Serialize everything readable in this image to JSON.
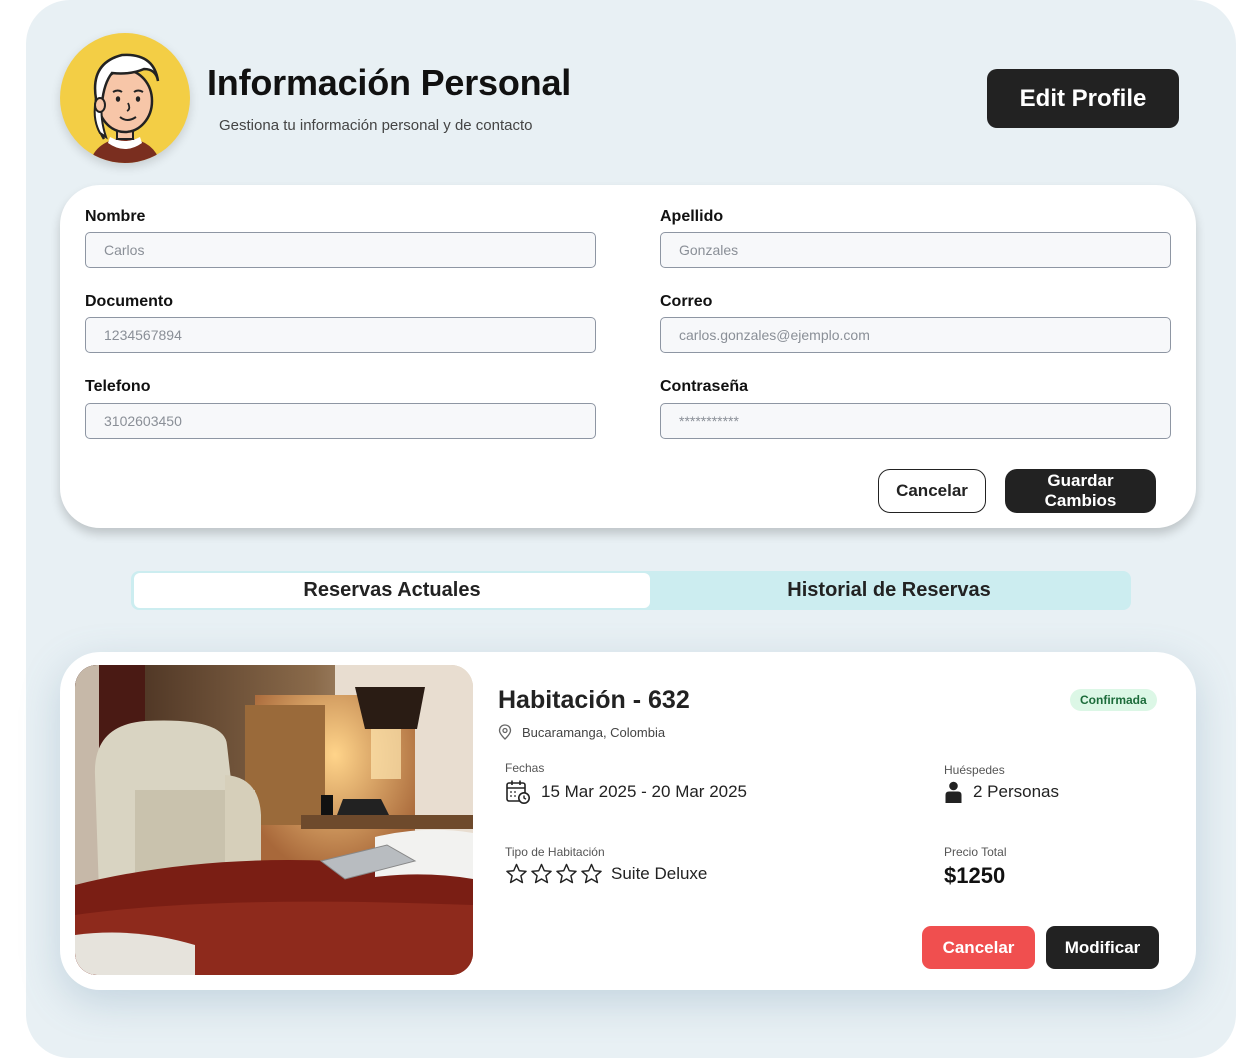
{
  "header": {
    "title": "Información Personal",
    "subtitle": "Gestiona tu información personal y de contacto",
    "edit_label": "Edit Profile",
    "avatar_icon": "user-avatar-illustration"
  },
  "form": {
    "fields": [
      {
        "label": "Nombre",
        "value": "Carlos"
      },
      {
        "label": "Apellido",
        "value": "Gonzales"
      },
      {
        "label": "Documento",
        "value": "1234567894"
      },
      {
        "label": "Correo",
        "value": "carlos.gonzales@ejemplo.com"
      },
      {
        "label": "Telefono",
        "value": "3102603450"
      },
      {
        "label": "Contraseña",
        "value": "***********"
      }
    ],
    "cancel_label": "Cancelar",
    "save_label": "Guardar Cambios"
  },
  "tabs": {
    "active": "Reservas Actuales",
    "inactive": "Historial de Reservas"
  },
  "reservation": {
    "title": "Habitación - 632",
    "status": "Confirmada",
    "location": "Bucaramanga, Colombia",
    "dates_label": "Fechas",
    "dates": "15 Mar 2025 - 20 Mar 2025",
    "guests_label": "Huéspedes",
    "guests": "2 Personas",
    "room_type_label": "Tipo de Habitación",
    "room_type": "Suite Deluxe",
    "stars": 4,
    "price_label": "Precio Total",
    "price": "$1250",
    "cancel_label": "Cancelar",
    "modify_label": "Modificar"
  },
  "colors": {
    "panel_bg": "#e8f0f4",
    "dark": "#222222",
    "danger": "#f04f4f",
    "tab_bg": "#ccedf0",
    "badge_bg": "#dcf7e6",
    "badge_text": "#1c6b3a",
    "avatar_bg": "#f3ce45"
  }
}
